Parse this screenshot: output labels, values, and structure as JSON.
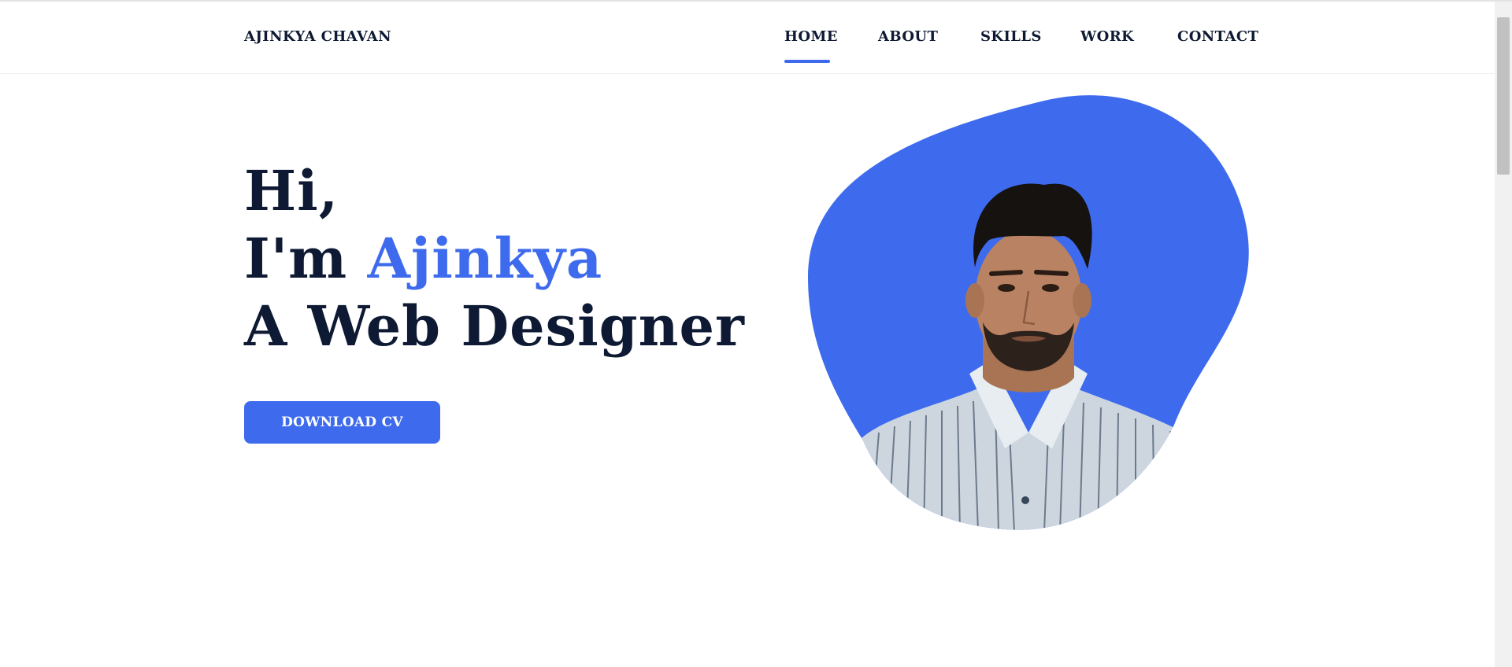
{
  "header": {
    "brand": "AJINKYA CHAVAN",
    "nav": {
      "home": "HOME",
      "about": "ABOUT",
      "skills": "SKILLS",
      "work": "WORK",
      "contact": "CONTACT"
    },
    "active_item": "HOME"
  },
  "hero": {
    "line1": "Hi,",
    "line2_prefix": "I'm ",
    "line2_name": "Ajinkya",
    "line3": "A Web Designer",
    "button_label": "DOWNLOAD CV",
    "photo_icon": "profile-photo"
  },
  "colors": {
    "accent": "#3e6bee",
    "text": "#0e1a33",
    "background": "#ffffff"
  }
}
